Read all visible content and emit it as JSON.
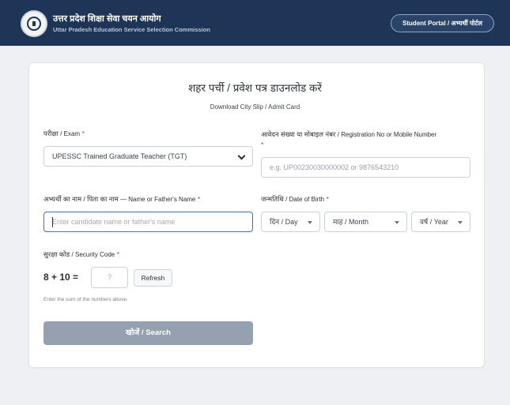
{
  "header": {
    "title_hi": "उत्तर प्रदेश शिक्षा सेवा चयन आयोग",
    "title_en": "Uttar Pradesh Education Service Selection Commission",
    "portal_button": "Student Portal / अभ्यर्थी पोर्टल",
    "logo_icon": "emblem-icon"
  },
  "form": {
    "title": "शहर पर्ची / प्रवेश पत्र डाउनलोड करें",
    "subtitle": "Download City Slip / Admit Card",
    "exam": {
      "label_hi": "परीक्षा",
      "label_en": "/ Exam",
      "required": "*",
      "value": "UPESSC Trained Graduate Teacher (TGT)"
    },
    "registration": {
      "label_hi": "आवेदन संख्या या मोबाइल नंबर",
      "label_en": "/ Registration No or Mobile Number",
      "required": "*",
      "placeholder": "e.g. UP00230030000002 or 9876543210"
    },
    "name": {
      "label_hi": "अभ्यर्थी का नाम / पिता का नाम",
      "label_en": "— Name or Father's Name",
      "required": "*",
      "placeholder": "Enter candidate name or father's name"
    },
    "dob": {
      "label_hi": "जन्मतिथि",
      "label_en": "/ Date of Birth",
      "required": "*",
      "day": "दिन / Day",
      "month": "माह / Month",
      "year": "वर्ष / Year"
    },
    "security": {
      "label_hi": "सुरक्षा कोड",
      "label_en": "/ Security Code",
      "required": "*",
      "question": "8 + 10 =",
      "placeholder": "?",
      "refresh": "Refresh",
      "hint": "Enter the sum of the numbers above."
    },
    "search_button": "खोजें / Search"
  },
  "colors": {
    "header_bg": "#1f3557",
    "focus_border": "#3a6fd8",
    "required": "#d9342b",
    "button_disabled": "#95a1b1"
  }
}
